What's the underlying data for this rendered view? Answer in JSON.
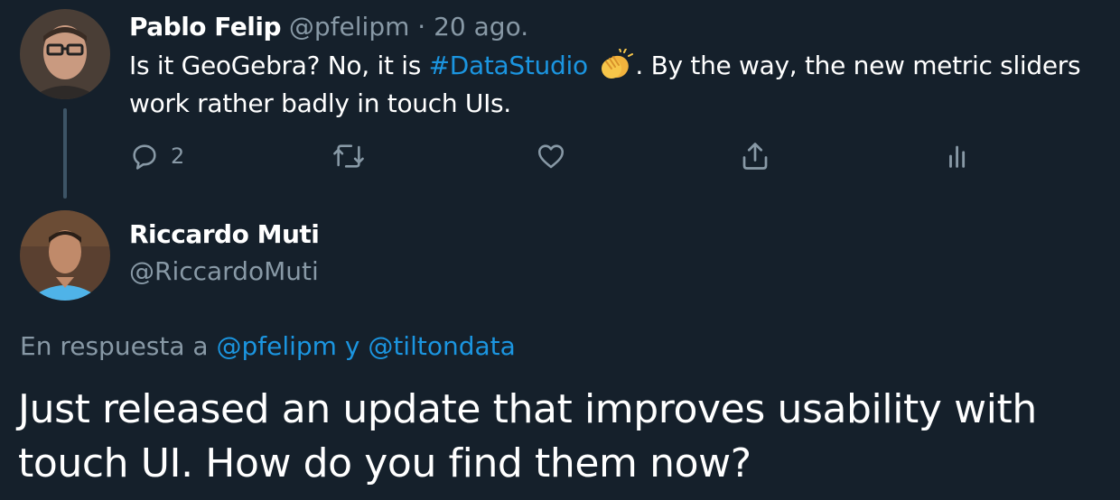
{
  "tweet": {
    "author_name": "Pablo Felip",
    "author_handle": "@pfelipm",
    "separator": "·",
    "date": "20 ago.",
    "text_before": "Is it GeoGebra? No, it is ",
    "hashtag": "#DataStudio",
    "emoji": "clapping-hands",
    "text_after": ". By the way, the new metric sliders work rather badly in touch UIs.",
    "reply_count": "2"
  },
  "reply": {
    "author_name": "Riccardo Muti",
    "author_handle": "@RiccardoMuti",
    "in_reply_prefix": "En respuesta a ",
    "in_reply_mentions": "@pfelipm y @tiltondata",
    "text": "Just released an update that improves usability with touch UI. How do you find them now?"
  },
  "colors": {
    "background": "#15202b",
    "text": "#ffffff",
    "muted": "#8899a6",
    "link": "#1b95e0",
    "thread_line": "#3d5466"
  },
  "icons": {
    "reply": "reply-icon",
    "retweet": "retweet-icon",
    "like": "heart-icon",
    "share": "share-icon",
    "analytics": "analytics-icon"
  }
}
